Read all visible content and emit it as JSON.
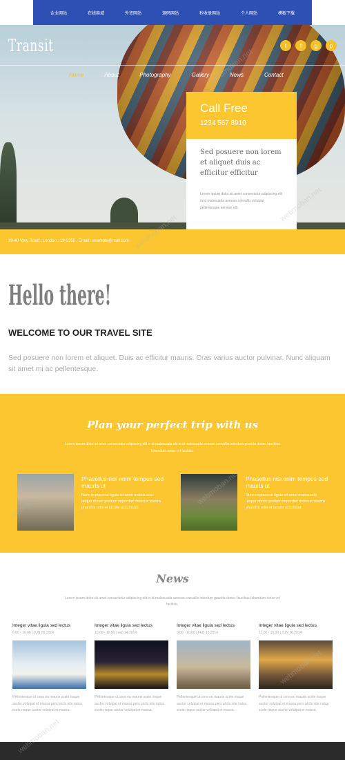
{
  "topnav": {
    "items": [
      "企业网站",
      "在线商城",
      "外贸网站",
      "源码网站",
      "秒收录网站",
      "个人网站",
      "模板下载"
    ]
  },
  "hero": {
    "logo": "Transit",
    "social": [
      "twitter-icon",
      "facebook-icon",
      "google-plus-icon",
      "pinterest-icon"
    ],
    "menu": [
      "Home",
      "About",
      "Photography",
      "Gallery",
      "News",
      "Contact"
    ],
    "active_menu_index": 0,
    "call": {
      "title": "Call Free",
      "number": "1234 567 8910"
    },
    "slider": {
      "heading": "Sed posuere non lorem et aliquet duis ac efficitur efficitur",
      "text": "Lorem ipsum dolor sit amet consectetur adipiscing elit in id malesuada aenean convallis volutpat pellentesque aenean elit.",
      "dots": 2,
      "active_dot": 1
    },
    "address": "39-40 Vary Road , London , 19-3350 , Email : example@mail.com"
  },
  "hello": {
    "title": "Hello there!",
    "subtitle": "WELCOME TO OUR TRAVEL SITE",
    "text": "Sed posuere non lorem et aliquet. Duis ac efficitur mauris. Cras varius auctor pulvinar. Nunc aliquam sit amet mi ac pellentesque."
  },
  "plan": {
    "title": "Plan your perfect trip with us",
    "text": "Lorem ipsum dolor sit amet consectetur adipiscing elit in id malesuada elit in id malesuada aenean convallis interdum gravida donec faucibus bibendum tortor vel facilisis.",
    "cards": [
      {
        "heading": "Phasellus nisi enim tempus sed mauris ut",
        "text": "Nunc in placerat ligula sit amet malesuada neque donec pretium imperdiet rhoncus viverra pharetra odio et iaculis accumsan."
      },
      {
        "heading": "Phasellus nisi enim tempus sed mauris ut",
        "text": "Nunc in placerat ligula sit amet malesuada neque donec pretium imperdiet rhoncus viverra pharetra odio et iaculis accumsan."
      }
    ]
  },
  "news": {
    "title": "News",
    "text": "Lorem ipsum dolor sit amet consectetur adipiscing elit in id malesuada aenean convallis interdum gravida donec faucibus bibendum tortor vel facilisis.",
    "items": [
      {
        "heading": "Integer vitae ligula sed lectus",
        "date": "6.00 - 10.00 | JUN 09.2014",
        "text": "Pellentesque ut urna eu mauris scele risque auctor volutpat et massa pers picils nite natus scele risque auctor volutpat et massa."
      },
      {
        "heading": "Integer vitae ligula sed lectus",
        "date": "10.00 - 12.00 | sep 24.2014",
        "text": "Pellentesque ut urna eu mauris scele risque auctor volutpat et massa pers picils nite natus scele risque auctor volutpat et massa."
      },
      {
        "heading": "Integer vitae ligula sed lectus",
        "date": "9.00 - 10.00 | FEB 10.2014",
        "text": "Pellentesque ut urna eu mauris scele risque auctor volutpat et massa pers picils nite natus scele risque auctor volutpat et massa."
      },
      {
        "heading": "Integer vitae ligula sed lectus",
        "date": "11.00 - 10.00 | JUN 10.2014",
        "text": "Pellentesque ut urna eu mauris scele risque auctor volutpat et massa pers picils nite natus scele risque auctor volutpat et massa."
      }
    ]
  },
  "watermark": "webmoban.net",
  "colors": {
    "accent": "#fbc630",
    "topnav": "#2e4fb4",
    "footer": "#2b2b2b"
  }
}
